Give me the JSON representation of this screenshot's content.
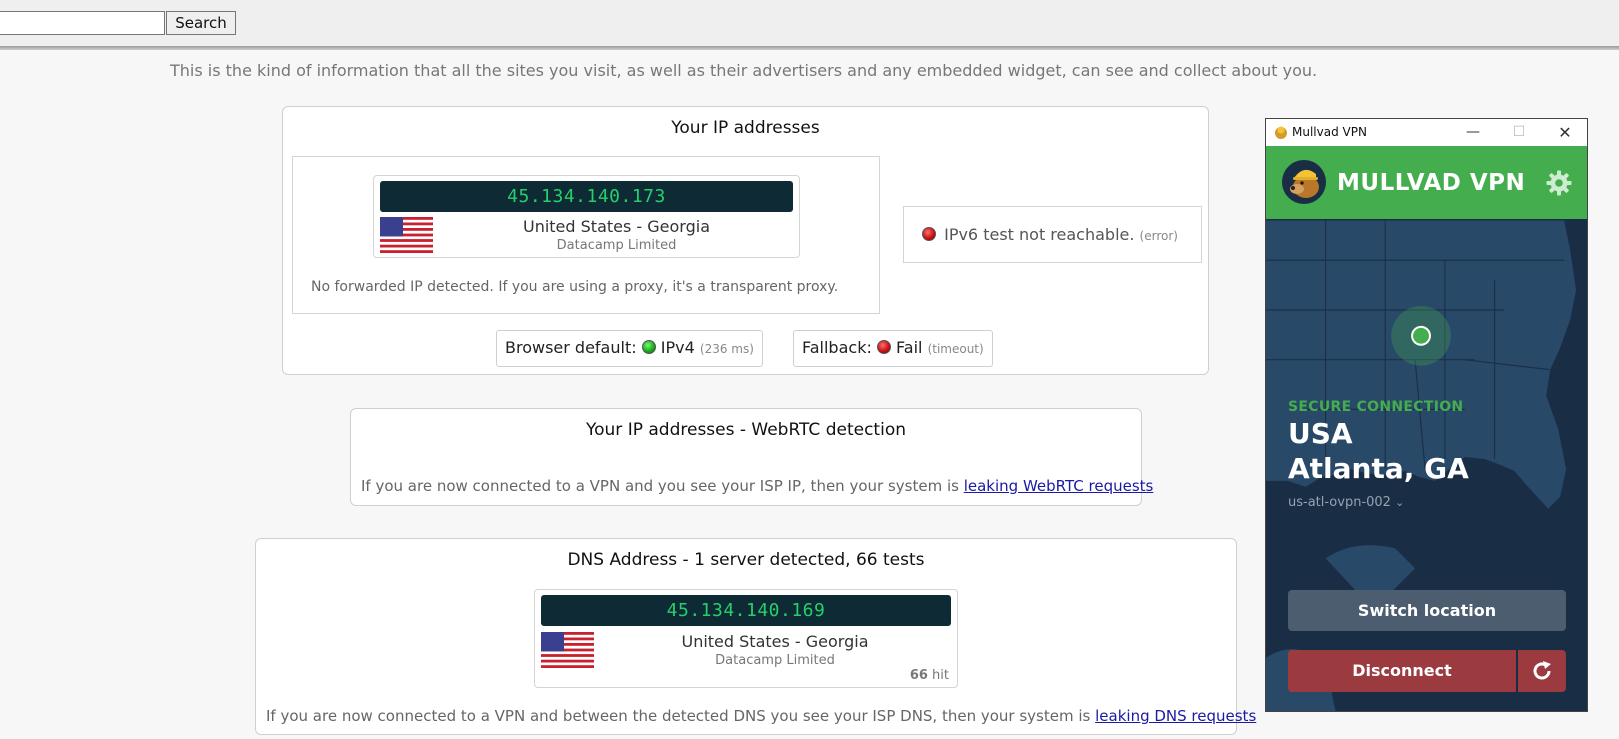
{
  "search": {
    "placeholder": "",
    "button_label": "Search"
  },
  "intro": "This is the kind of information that all the sites you visit, as well as their advertisers and any embedded widget, can see and collect about you.",
  "ip_panel": {
    "title": "Your IP addresses",
    "ipv4": {
      "ip": "45.134.140.173",
      "location": "United States - Georgia",
      "isp": "Datacamp Limited"
    },
    "forwarded_note": "No forwarded IP detected. If you are using a proxy, it's a transparent proxy.",
    "ipv6": {
      "text": "IPv6 test not reachable.",
      "detail": "(error)",
      "status_color": "#c40d0d"
    },
    "browser_default": {
      "label": "Browser default:",
      "value": "IPv4",
      "detail": "(236 ms)",
      "status_color": "#18a318"
    },
    "fallback": {
      "label": "Fallback:",
      "value": "Fail",
      "detail": "(timeout)",
      "status_color": "#c40d0d"
    }
  },
  "webrtc_panel": {
    "title": "Your IP addresses - WebRTC detection",
    "note": "If you are now connected to a VPN and you see your ISP IP, then your system is",
    "link": "leaking WebRTC requests"
  },
  "dns_panel": {
    "title": "DNS Address - 1 server detected, 66 tests",
    "server": {
      "ip": "45.134.140.169",
      "location": "United States - Georgia",
      "isp": "Datacamp Limited",
      "hits": "66",
      "hits_label": "hit"
    },
    "note": "If you are now connected to a VPN and between the detected DNS you see your ISP DNS, then your system is",
    "link": "leaking DNS requests"
  },
  "mullvad": {
    "window_title": "Mullvad VPN",
    "brand": "MULLVAD VPN",
    "status": "SECURE CONNECTION",
    "country": "USA",
    "city": "Atlanta, GA",
    "server": "us-atl-ovpn-002",
    "switch_label": "Switch location",
    "disconnect_label": "Disconnect",
    "colors": {
      "accent_green": "#44ad4d",
      "background": "#192e45",
      "disconnect_red": "#9b3a3f"
    },
    "icons": [
      "mullvad-logo-icon",
      "gear-icon",
      "chevron-down-icon",
      "reconnect-icon",
      "minimize-icon",
      "maximize-icon",
      "close-icon"
    ]
  }
}
